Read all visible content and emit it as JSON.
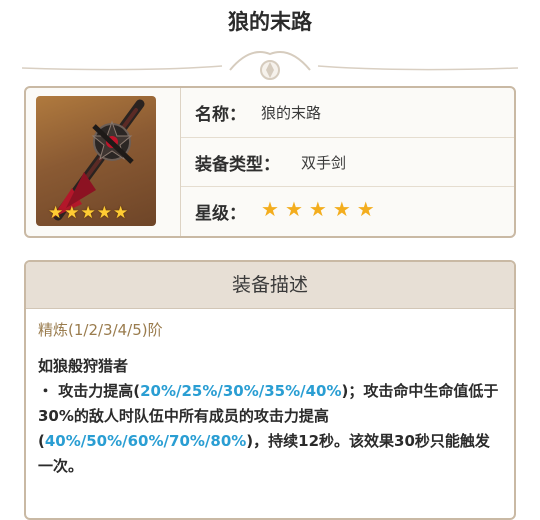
{
  "page": {
    "title": "狼的末路"
  },
  "weapon": {
    "icon": "greatsword-icon",
    "rarity_count": 5
  },
  "info": {
    "name_label": "名称：",
    "name_value": "狼的末路",
    "type_label": "装备类型：",
    "type_value": "双手剑",
    "stars_label": "星级：",
    "stars": 5
  },
  "description": {
    "header": "装备描述",
    "refinement": "精炼(1/2/3/4/5)阶",
    "passive_name": "如狼般狩猎者",
    "segments": [
      {
        "text": "・ 攻击力提高(",
        "hl": false
      },
      {
        "text": "20%/25%/30%/35%/40%",
        "hl": true
      },
      {
        "text": ")；攻击命中生命值低于30%的敌人时队伍中所有成员的攻击力提高(",
        "hl": false
      },
      {
        "text": "40%/50%/60%/70%/80%",
        "hl": true
      },
      {
        "text": ")，持续12秒。该效果30秒只能触发一次。",
        "hl": false
      }
    ]
  },
  "colors": {
    "highlight": "#2a9ed3",
    "star": "#f3ad1e",
    "border": "#c9b9a4",
    "header_bg": "#e7dfd5"
  }
}
